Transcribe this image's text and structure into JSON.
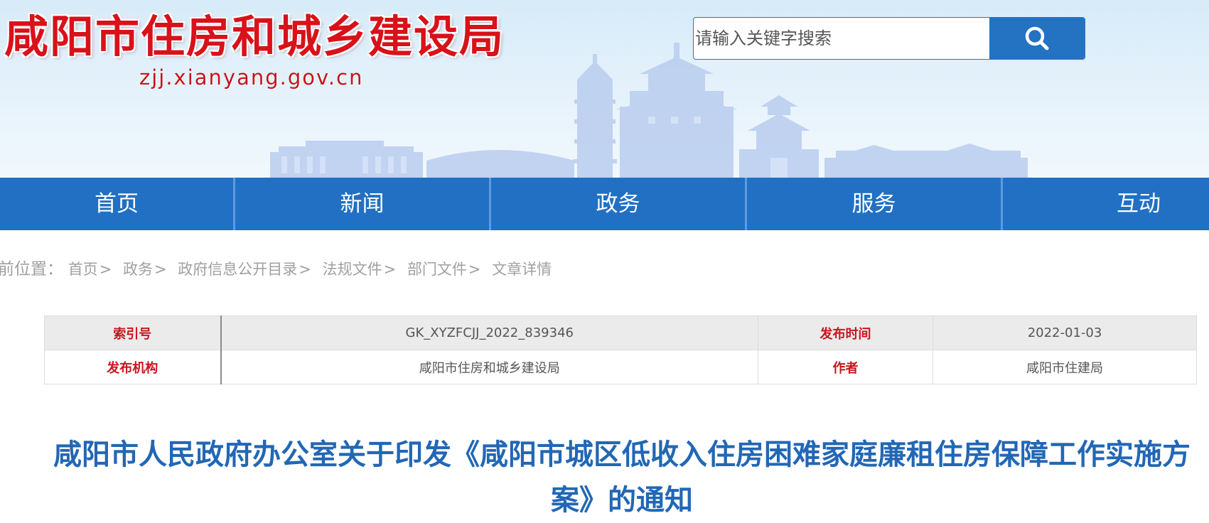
{
  "header": {
    "site_title": "咸阳市住房和城乡建设局",
    "site_domain": "zjj.xianyang.gov.cn",
    "search": {
      "placeholder": "请输入关键字搜索",
      "value": "",
      "button_icon": "search-icon"
    }
  },
  "nav": {
    "items": [
      {
        "label": "首页"
      },
      {
        "label": "新闻"
      },
      {
        "label": "政务"
      },
      {
        "label": "服务"
      },
      {
        "label": "互动"
      }
    ]
  },
  "breadcrumb": {
    "prefix": "前位置：",
    "items": [
      "首页",
      "政务",
      "政府信息公开目录",
      "法规文件",
      "部门文件"
    ],
    "separator": ">",
    "current": "文章详情"
  },
  "info_table": {
    "rows": [
      {
        "label1": "索引号",
        "value1": "GK_XYZFCJJ_2022_839346",
        "label2": "发布时间",
        "value2": "2022-01-03"
      },
      {
        "label1": "发布机构",
        "value1": "咸阳市住房和城乡建设局",
        "label2": "作者",
        "value2": "咸阳市住建局"
      }
    ]
  },
  "article": {
    "title": "咸阳市人民政府办公室关于印发《咸阳市城区低收入住房困难家庭廉租住房保障工作实施方案》的通知"
  },
  "colors": {
    "title_red": "#d8121a",
    "nav_blue": "#2170c3",
    "search_blue": "#2472c2",
    "label_red": "#c8161e",
    "article_title_blue": "#2267b5",
    "breadcrumb_gray": "#a0a0a0"
  }
}
